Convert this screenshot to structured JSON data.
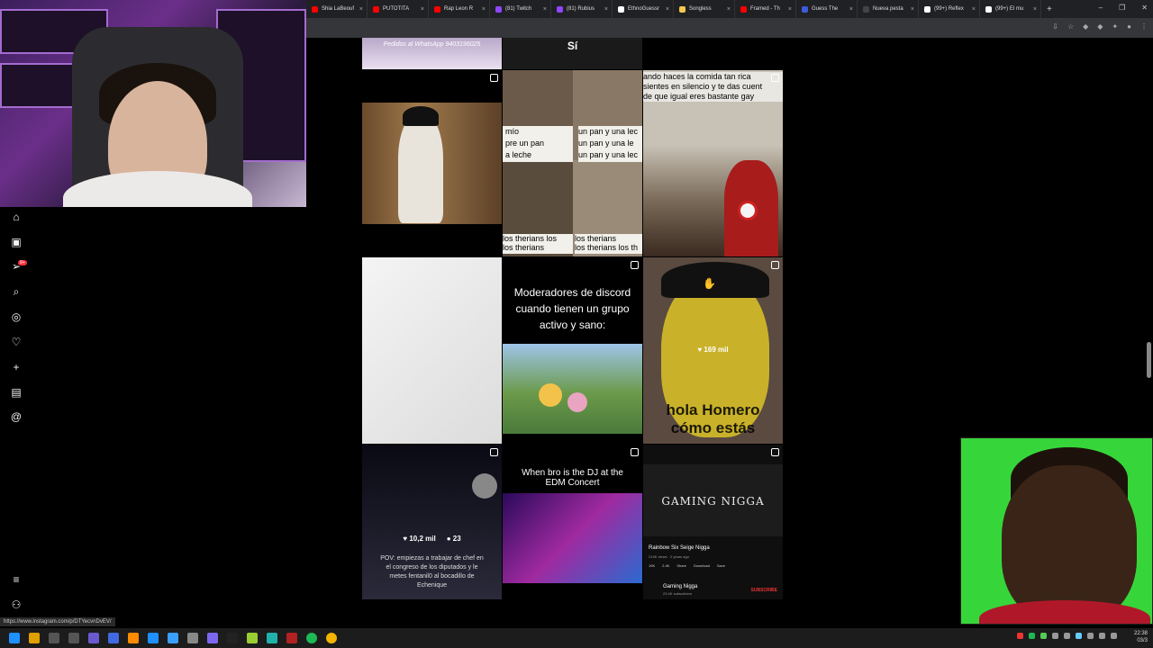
{
  "browser": {
    "tabs": [
      {
        "label": "Shia LaBeouf",
        "color": "#ff0000"
      },
      {
        "label": "PUTOTITA",
        "color": "#ff0000"
      },
      {
        "label": "Rap Leon R",
        "color": "#ff0000"
      },
      {
        "label": "(81) Twitch",
        "color": "#9146ff"
      },
      {
        "label": "(81) Rubius",
        "color": "#9146ff"
      },
      {
        "label": "EthnoGuessr",
        "color": "#ffffff"
      },
      {
        "label": "Songless",
        "color": "#f2c94c"
      },
      {
        "label": "Framed - Th",
        "color": "#ff0000"
      },
      {
        "label": "Guess The",
        "color": "#3b5bdb"
      },
      {
        "label": "Nueva pesta",
        "color": "#444444"
      },
      {
        "label": "(99+) Reflex",
        "color": "#ffffff"
      },
      {
        "label": "(99+) El mu",
        "color": "#ffffff"
      }
    ],
    "new_tab": "+",
    "window_controls": [
      "–",
      "❐",
      "✕"
    ],
    "status_url": "https://www.instagram.com/p/DTYecvnDvEV/"
  },
  "sidebar": {
    "items": [
      {
        "name": "home-icon",
        "glyph": "⌂"
      },
      {
        "name": "reels-icon",
        "glyph": "▣"
      },
      {
        "name": "send-icon",
        "glyph": "➢"
      },
      {
        "name": "search-icon",
        "glyph": "⌕"
      },
      {
        "name": "explore-icon",
        "glyph": "◎"
      },
      {
        "name": "heart-icon",
        "glyph": "♡"
      },
      {
        "name": "create-icon",
        "glyph": "+"
      },
      {
        "name": "dashboard-icon",
        "glyph": "▤"
      },
      {
        "name": "threads-icon",
        "glyph": "@"
      },
      {
        "name": "menu-icon",
        "glyph": "≡"
      },
      {
        "name": "meta-icon",
        "glyph": "⚇"
      }
    ],
    "notification_badge": "9+"
  },
  "posts": {
    "top_left_caption": "Pedidos al WhatsApp 9403196025",
    "top_mid_caption": "Sí",
    "meme_left_lines": [
      "mío",
      "pre un pan",
      "a leche"
    ],
    "meme_right_lines": [
      "un pan y una lec",
      "un pan y una le",
      "un pan y una lec"
    ],
    "meme_bottom_left": "los therians los\nlos therians",
    "meme_bottom_right": "los therians\nlos therians los th",
    "ironman_caption": "ando haces la comida tan rica\nsientes en silencio y te das cuent\nde que igual eres bastante gay",
    "discord_caption": "Moderadores de discord cuando tienen un grupo activo y sano:",
    "homer_likes": "169 mil",
    "homer_caption": "hola Homero\ncómo estás",
    "pov_likes": "10,2 mil",
    "pov_comments": "23",
    "pov_caption": "POV: empiezas a trabajar de chef en el congreso de los diputados y le metes fentanil0 al bocadillo de Echenique",
    "dj_caption": "When bro is the DJ at the EDM Concert",
    "yt_channel_banner": "GAMING NIGGA",
    "yt_video_title": "Rainbow Six Seige Nigga",
    "yt_meta": "214K views · 2 years ago",
    "yt_actions": [
      "19K",
      "2.4K",
      "Share",
      "Download",
      "Save"
    ],
    "yt_channel_name": "Gaming Nigga",
    "yt_subs": "23.4K subscribers",
    "yt_subscribe": "SUBSCRIBE"
  },
  "taskbar": {
    "time": "22:38",
    "date": "03/3"
  }
}
